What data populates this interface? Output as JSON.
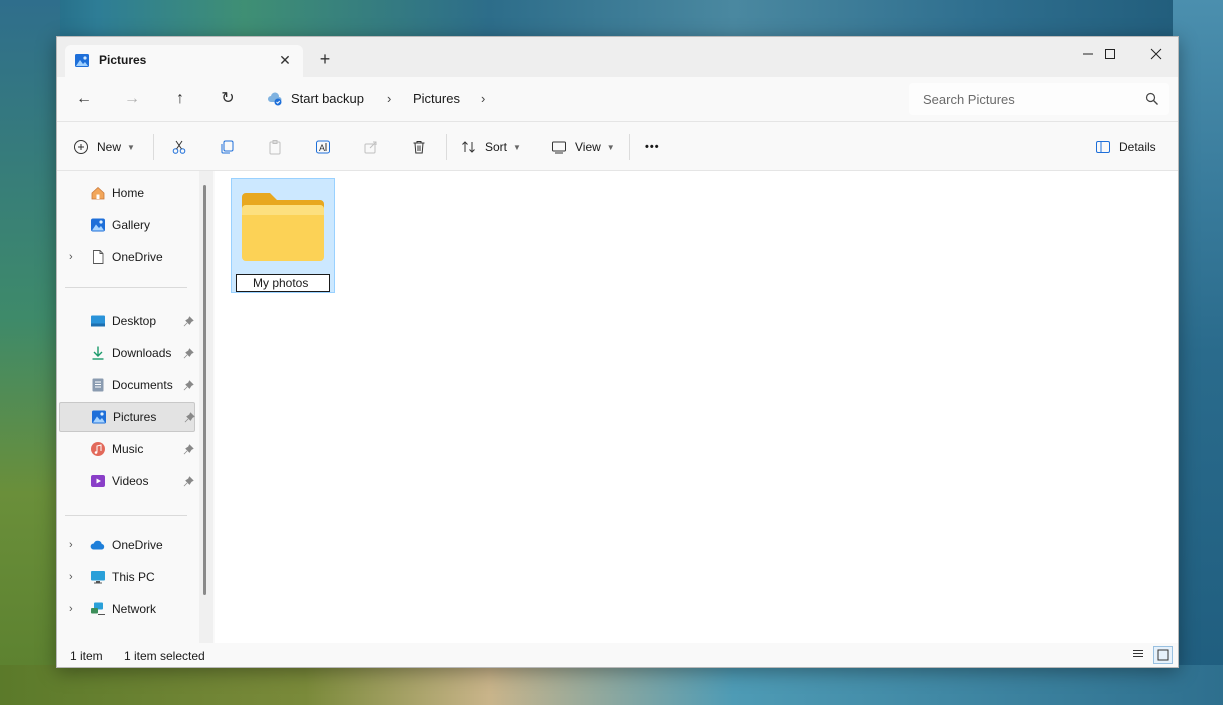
{
  "titlebar": {
    "tab_label": "Pictures",
    "tab_close": "✕",
    "new_tab": "+",
    "minimize": "—",
    "maximize": "☐",
    "close": "✕"
  },
  "nav": {
    "back": "←",
    "forward": "→",
    "up": "↑",
    "refresh": "↻",
    "breadcrumbs": [
      "Start backup",
      "Pictures"
    ],
    "search_placeholder": "Search Pictures"
  },
  "toolbar": {
    "new_label": "New",
    "sort_label": "Sort",
    "view_label": "View",
    "more_label": "•••",
    "details_label": "Details"
  },
  "sidebar": {
    "quick": [
      {
        "label": "Home",
        "icon": "home-icon"
      },
      {
        "label": "Gallery",
        "icon": "gallery-icon"
      },
      {
        "label": "OneDrive",
        "icon": "onedrive-personal-icon"
      }
    ],
    "pinned": [
      {
        "label": "Desktop",
        "icon": "desktop-icon"
      },
      {
        "label": "Downloads",
        "icon": "downloads-icon"
      },
      {
        "label": "Documents",
        "icon": "documents-icon"
      },
      {
        "label": "Pictures",
        "icon": "pictures-icon"
      },
      {
        "label": "Music",
        "icon": "music-icon"
      },
      {
        "label": "Videos",
        "icon": "videos-icon"
      }
    ],
    "locations": [
      {
        "label": "OneDrive",
        "icon": "onedrive-cloud-icon"
      },
      {
        "label": "This PC",
        "icon": "this-pc-icon"
      },
      {
        "label": "Network",
        "icon": "network-icon"
      }
    ],
    "chevron": "›"
  },
  "content": {
    "folder_name_value": "My photos"
  },
  "status": {
    "count": "1 item",
    "selected": "1 item selected"
  },
  "colors": {
    "selection_fill": "#cce8ff",
    "selection_border": "#99d1ff",
    "folder_yellow": "#f8c64b"
  }
}
